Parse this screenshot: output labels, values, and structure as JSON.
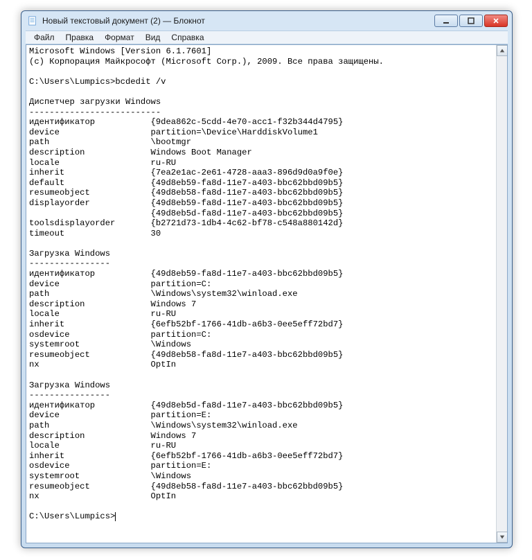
{
  "window": {
    "title": "Новый текстовый документ (2) — Блокнот"
  },
  "menu": {
    "file": "Файл",
    "edit": "Правка",
    "format": "Формат",
    "view": "Вид",
    "help": "Справка"
  },
  "content": {
    "header1": "Microsoft Windows [Version 6.1.7601]",
    "header2": "(c) Корпорация Майкрософт (Microsoft Corp.), 2009. Все права защищены.",
    "prompt1_prefix": "C:\\Users\\Lumpics>",
    "prompt1_cmd": "bcdedit /v",
    "section1_title": "Диспетчер загрузки Windows",
    "section1_divider": "--------------------------",
    "section2_title": "Загрузка Windows",
    "section2_divider": "----------------",
    "section3_title": "Загрузка Windows",
    "section3_divider": "----------------",
    "bootmgr": [
      [
        "идентификатор",
        "{9dea862c-5cdd-4e70-acc1-f32b344d4795}"
      ],
      [
        "device",
        "partition=\\Device\\HarddiskVolume1"
      ],
      [
        "path",
        "\\bootmgr"
      ],
      [
        "description",
        "Windows Boot Manager"
      ],
      [
        "locale",
        "ru-RU"
      ],
      [
        "inherit",
        "{7ea2e1ac-2e61-4728-aaa3-896d9d0a9f0e}"
      ],
      [
        "default",
        "{49d8eb59-fa8d-11e7-a403-bbc62bbd09b5}"
      ],
      [
        "resumeobject",
        "{49d8eb58-fa8d-11e7-a403-bbc62bbd09b5}"
      ],
      [
        "displayorder",
        "{49d8eb59-fa8d-11e7-a403-bbc62bbd09b5}"
      ],
      [
        "",
        "{49d8eb5d-fa8d-11e7-a403-bbc62bbd09b5}"
      ],
      [
        "toolsdisplayorder",
        "{b2721d73-1db4-4c62-bf78-c548a880142d}"
      ],
      [
        "timeout",
        "30"
      ]
    ],
    "loader1": [
      [
        "идентификатор",
        "{49d8eb59-fa8d-11e7-a403-bbc62bbd09b5}"
      ],
      [
        "device",
        "partition=C:"
      ],
      [
        "path",
        "\\Windows\\system32\\winload.exe"
      ],
      [
        "description",
        "Windows 7"
      ],
      [
        "locale",
        "ru-RU"
      ],
      [
        "inherit",
        "{6efb52bf-1766-41db-a6b3-0ee5eff72bd7}"
      ],
      [
        "osdevice",
        "partition=C:"
      ],
      [
        "systemroot",
        "\\Windows"
      ],
      [
        "resumeobject",
        "{49d8eb58-fa8d-11e7-a403-bbc62bbd09b5}"
      ],
      [
        "nx",
        "OptIn"
      ]
    ],
    "loader2": [
      [
        "идентификатор",
        "{49d8eb5d-fa8d-11e7-a403-bbc62bbd09b5}"
      ],
      [
        "device",
        "partition=E:"
      ],
      [
        "path",
        "\\Windows\\system32\\winload.exe"
      ],
      [
        "description",
        "Windows 7"
      ],
      [
        "locale",
        "ru-RU"
      ],
      [
        "inherit",
        "{6efb52bf-1766-41db-a6b3-0ee5eff72bd7}"
      ],
      [
        "osdevice",
        "partition=E:"
      ],
      [
        "systemroot",
        "\\Windows"
      ],
      [
        "resumeobject",
        "{49d8eb58-fa8d-11e7-a403-bbc62bbd09b5}"
      ],
      [
        "nx",
        "OptIn"
      ]
    ],
    "prompt2_prefix": "C:\\Users\\Lumpics>"
  }
}
